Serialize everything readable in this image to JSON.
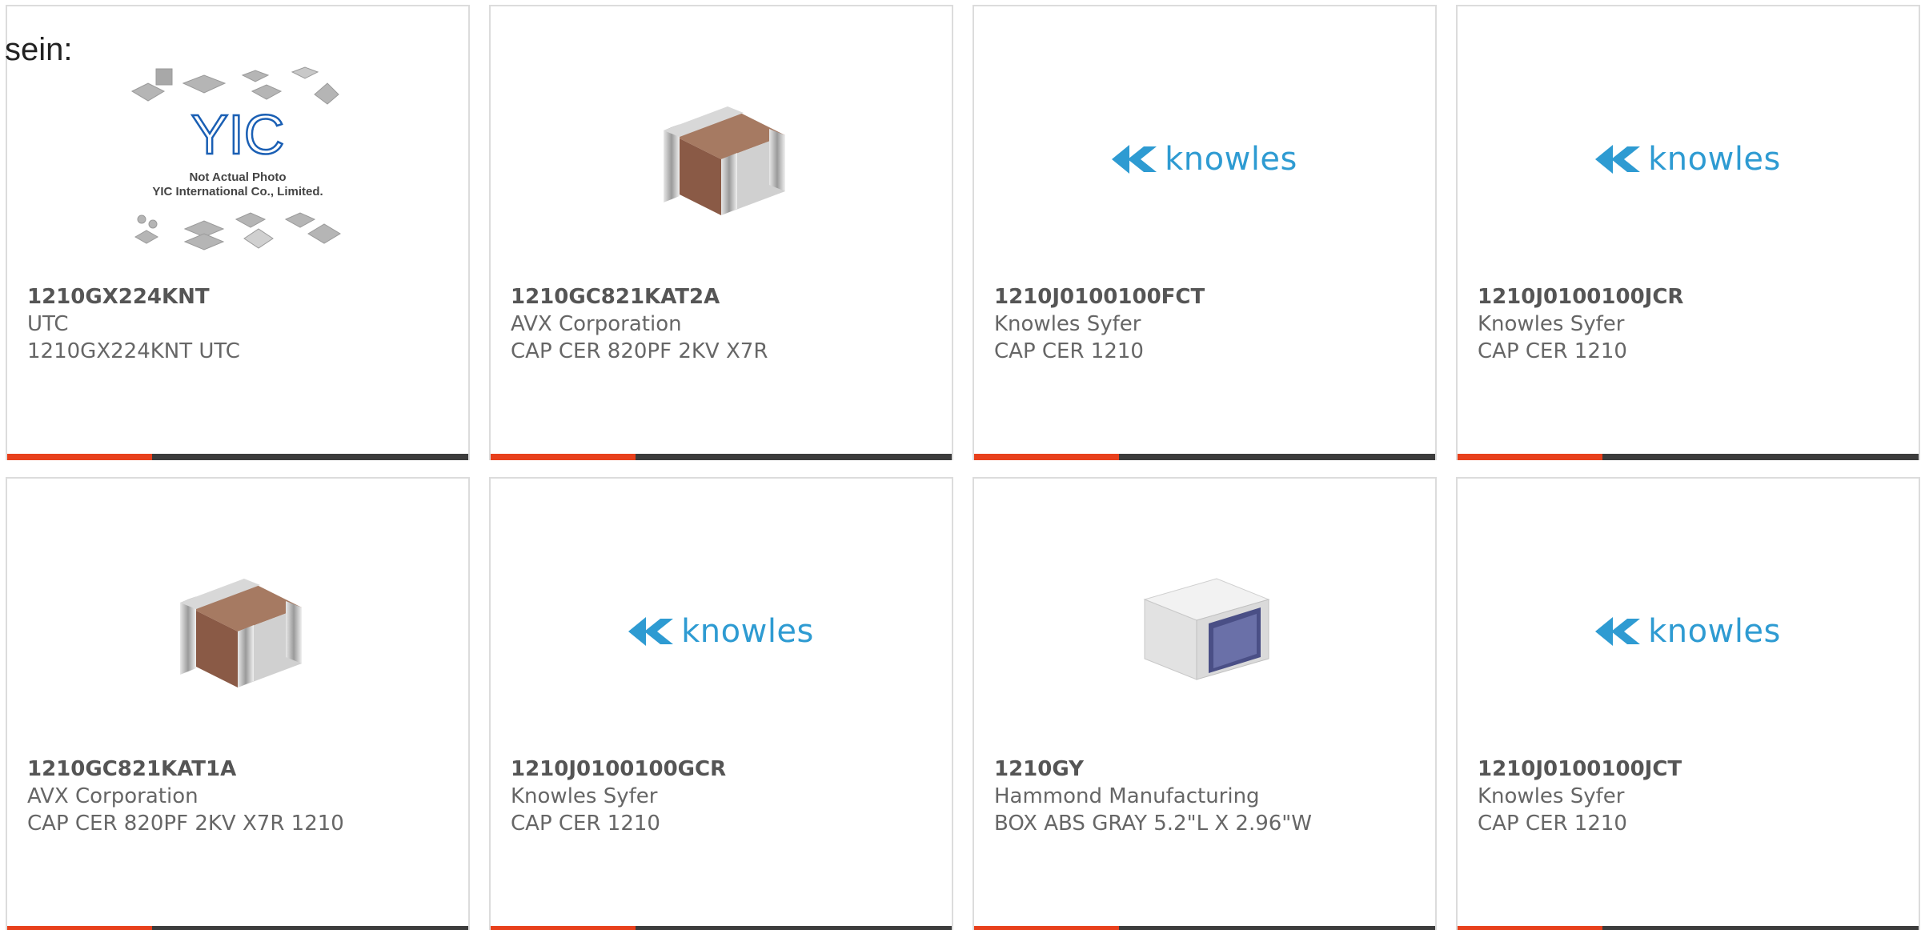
{
  "lead_text": "sein:",
  "colors": {
    "accent": "#e8401c",
    "bar": "#3c3c3c",
    "knowles_blue": "#2e9bd2",
    "yic_blue": "#1a5fb4"
  },
  "cards": [
    {
      "part_number": "1210GX224KNT",
      "manufacturer": "UTC",
      "description": "1210GX224KNT UTC",
      "image": "yic-placeholder",
      "image_caption_1": "Not Actual Photo",
      "image_caption_2": "YIC International Co., Limited.",
      "logo_text": "YIC"
    },
    {
      "part_number": "1210GC821KAT2A",
      "manufacturer": "AVX Corporation",
      "description": "CAP CER 820PF 2KV X7R",
      "image": "ceramic-capacitor"
    },
    {
      "part_number": "1210J0100100FCT",
      "manufacturer": "Knowles Syfer",
      "description": "CAP CER 1210",
      "image": "knowles-logo",
      "logo_text": "knowles"
    },
    {
      "part_number": "1210J0100100JCR",
      "manufacturer": "Knowles Syfer",
      "description": "CAP CER 1210",
      "image": "knowles-logo",
      "logo_text": "knowles"
    },
    {
      "part_number": "1210GC821KAT1A",
      "manufacturer": "AVX Corporation",
      "description": "CAP CER 820PF 2KV X7R 1210",
      "image": "ceramic-capacitor"
    },
    {
      "part_number": "1210J0100100GCR",
      "manufacturer": "Knowles Syfer",
      "description": "CAP CER 1210",
      "image": "knowles-logo",
      "logo_text": "knowles"
    },
    {
      "part_number": "1210GY",
      "manufacturer": "Hammond Manufacturing",
      "description": "BOX ABS GRAY 5.2\"L X 2.96\"W",
      "image": "plastic-enclosure"
    },
    {
      "part_number": "1210J0100100JCT",
      "manufacturer": "Knowles Syfer",
      "description": "CAP CER 1210",
      "image": "knowles-logo",
      "logo_text": "knowles"
    }
  ]
}
